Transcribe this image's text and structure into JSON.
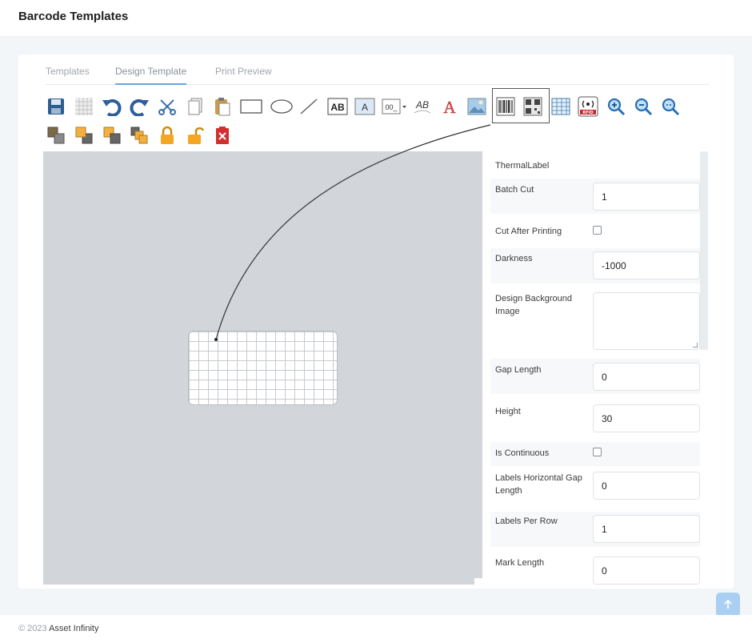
{
  "app": {
    "title": "Barcode Templates"
  },
  "tabs": [
    {
      "label": "Templates",
      "active": false
    },
    {
      "label": "Design Template",
      "active": true
    },
    {
      "label": "Print Preview",
      "active": false
    }
  ],
  "toolbar": {
    "row1": [
      "save-icon",
      "grid-icon",
      "undo-icon",
      "redo-icon",
      "cut-icon",
      "copy-icon",
      "paste-icon",
      "rectangle-icon",
      "ellipse-icon",
      "line-icon",
      "text-icon",
      "text-box-icon",
      "numbering-icon",
      "curved-text-icon",
      "font-icon",
      "image-icon",
      "barcode-icon",
      "qr-code-icon",
      "table-icon",
      "rfid-icon",
      "zoom-in-icon",
      "zoom-out-icon",
      "zoom-fit-icon"
    ],
    "row2": [
      "bring-to-front-icon",
      "send-to-back-icon",
      "bring-forward-icon",
      "send-backward-icon",
      "lock-icon",
      "unlock-icon",
      "delete-icon"
    ],
    "text_glyph": "AB",
    "curved_glyph": "AB",
    "font_glyph": "A",
    "numbering_glyph": "00_",
    "rfid_label": "RFID"
  },
  "properties": {
    "header": "ThermalLabel",
    "batch_cut": {
      "label": "Batch Cut",
      "value": "1"
    },
    "cut_after_printing": {
      "label": "Cut After Printing",
      "checked": false
    },
    "darkness": {
      "label": "Darkness",
      "value": "-1000"
    },
    "design_background_image": {
      "label": "Design Background Image",
      "value": ""
    },
    "gap_length": {
      "label": "Gap Length",
      "value": "0"
    },
    "height": {
      "label": "Height",
      "value": "30"
    },
    "is_continuous": {
      "label": "Is Continuous",
      "checked": false
    },
    "labels_horizontal_gap_length": {
      "label": "Labels Horizontal Gap Length",
      "value": "0"
    },
    "labels_per_row": {
      "label": "Labels Per Row",
      "value": "1"
    },
    "mark_length": {
      "label": "Mark Length",
      "value": "0"
    }
  },
  "footer": {
    "copyright": "© 2023",
    "brand": "Asset Infinity"
  },
  "colors": {
    "accent": "#6aa6de",
    "canvas": "#d2d6da",
    "panel_shade": "#f6f8fa"
  }
}
